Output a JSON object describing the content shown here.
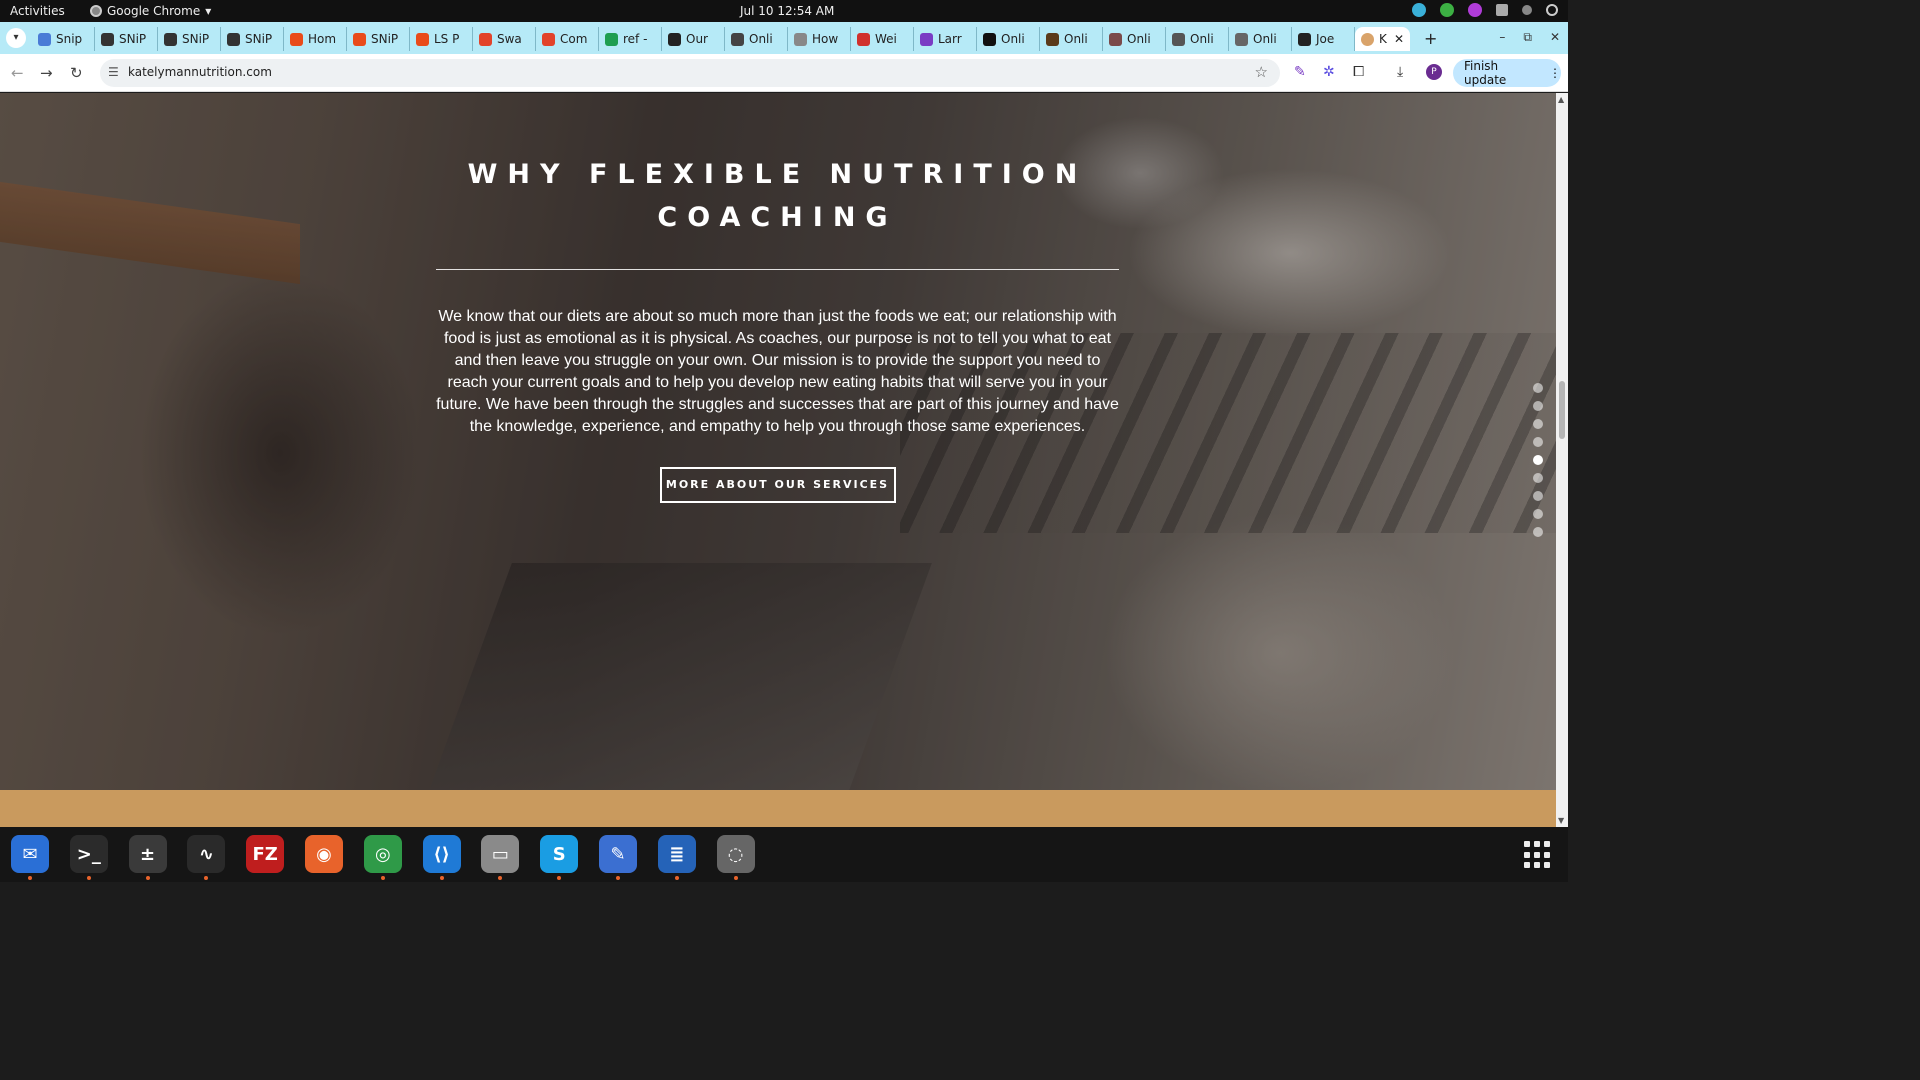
{
  "system": {
    "activities": "Activities",
    "app_name": "Google Chrome",
    "clock": "Jul 10  12:54 AM"
  },
  "tabs": [
    {
      "label": "Snip",
      "color": "#4a7bd6"
    },
    {
      "label": "SNiP",
      "color": "#333333"
    },
    {
      "label": "SNiP",
      "color": "#333333"
    },
    {
      "label": "SNiP",
      "color": "#333333"
    },
    {
      "label": "Hom",
      "color": "#e94b1a"
    },
    {
      "label": "SNiP",
      "color": "#e94b1a"
    },
    {
      "label": "LS P",
      "color": "#e94b1a"
    },
    {
      "label": "Swa",
      "color": "#e2432a"
    },
    {
      "label": "Com",
      "color": "#e2432a"
    },
    {
      "label": "ref -",
      "color": "#1e9e50"
    },
    {
      "label": "Our",
      "color": "#222222"
    },
    {
      "label": "Onli",
      "color": "#444444"
    },
    {
      "label": "How",
      "color": "#888888"
    },
    {
      "label": "Wei",
      "color": "#d0312d"
    },
    {
      "label": "Larr",
      "color": "#7a3cc4"
    },
    {
      "label": "Onli",
      "color": "#111111"
    },
    {
      "label": "Onli",
      "color": "#5a3a1a"
    },
    {
      "label": "Onli",
      "color": "#7a4a4a"
    },
    {
      "label": "Onli",
      "color": "#555555"
    },
    {
      "label": "Onli",
      "color": "#666666"
    },
    {
      "label": "Joe",
      "color": "#222222"
    }
  ],
  "active_tab": {
    "label": "K",
    "close": "✕",
    "color": "#d9a36a"
  },
  "window_controls": {
    "minimize": "–",
    "restore": "⧉",
    "close": "✕"
  },
  "toolbar": {
    "url": "katelymannutrition.com",
    "profile_initial": "P",
    "finish_update": "Finish update"
  },
  "page": {
    "headline": "WHY FLEXIBLE NUTRITION COACHING",
    "body": "We know that our diets are about so much more than just the foods we eat; our relationship with food is just as emotional as it is physical. As coaches, our purpose is not to tell you what to eat and then leave you struggle on your own. Our mission is to provide the support you need to reach your current goals and to help you  develop new eating habits that will serve you in your future. We have been through the struggles and successes that are part of this journey and have the knowledge, experience, and empathy to help you through those same experiences.",
    "cta": "MORE ABOUT OUR SERVICES",
    "section_dots_total": 9,
    "section_dots_active_index": 4,
    "band_color": "#c99a5e"
  },
  "dock": [
    {
      "name": "thunderbird",
      "glyph": "✉",
      "color": "#2a6fd6",
      "running": true
    },
    {
      "name": "terminal",
      "glyph": ">_",
      "color": "#2b2b2b",
      "running": true
    },
    {
      "name": "calculator",
      "glyph": "±",
      "color": "#3a3a3a",
      "running": true
    },
    {
      "name": "system-monitor",
      "glyph": "∿",
      "color": "#2a2a2a",
      "running": true
    },
    {
      "name": "filezilla",
      "glyph": "FZ",
      "color": "#bf1e1e",
      "running": false
    },
    {
      "name": "firefox",
      "glyph": "◉",
      "color": "#e8632b",
      "running": false
    },
    {
      "name": "chrome",
      "glyph": "◎",
      "color": "#2f9a48",
      "running": true
    },
    {
      "name": "vscode",
      "glyph": "⟨⟩",
      "color": "#1f7ad6",
      "running": true
    },
    {
      "name": "files",
      "glyph": "▭",
      "color": "#8a8a8a",
      "running": true
    },
    {
      "name": "skype",
      "glyph": "S",
      "color": "#1a9de3",
      "running": true
    },
    {
      "name": "text-editor",
      "glyph": "✎",
      "color": "#3b6fd1",
      "running": true
    },
    {
      "name": "writer",
      "glyph": "≣",
      "color": "#2563b8",
      "running": true
    },
    {
      "name": "disks",
      "glyph": "◌",
      "color": "#666666",
      "running": true
    }
  ]
}
